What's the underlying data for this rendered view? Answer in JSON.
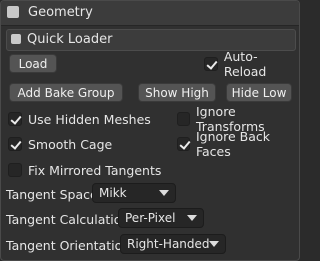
{
  "panel": {
    "title": "Geometry"
  },
  "quick_loader": {
    "title": "Quick Loader",
    "load_label": "Load",
    "auto_reload": {
      "label": "Auto-Reload",
      "checked": true
    }
  },
  "bake": {
    "add_group_label": "Add Bake Group",
    "show_high_label": "Show High",
    "hide_low_label": "Hide Low"
  },
  "options": {
    "use_hidden_meshes": {
      "label": "Use Hidden Meshes",
      "checked": true
    },
    "ignore_transforms": {
      "label": "Ignore Transforms",
      "checked": false
    },
    "smooth_cage": {
      "label": "Smooth Cage",
      "checked": true
    },
    "ignore_back_faces": {
      "label": "Ignore Back Faces",
      "checked": true
    },
    "fix_mirrored_tangents": {
      "label": "Fix Mirrored Tangents",
      "checked": false
    }
  },
  "tangent": {
    "space": {
      "label": "Tangent Space",
      "value": "Mikk"
    },
    "calculation": {
      "label": "Tangent Calculation",
      "value": "Per-Pixel"
    },
    "orientation": {
      "label": "Tangent Orientation",
      "value": "Right-Handed"
    }
  }
}
